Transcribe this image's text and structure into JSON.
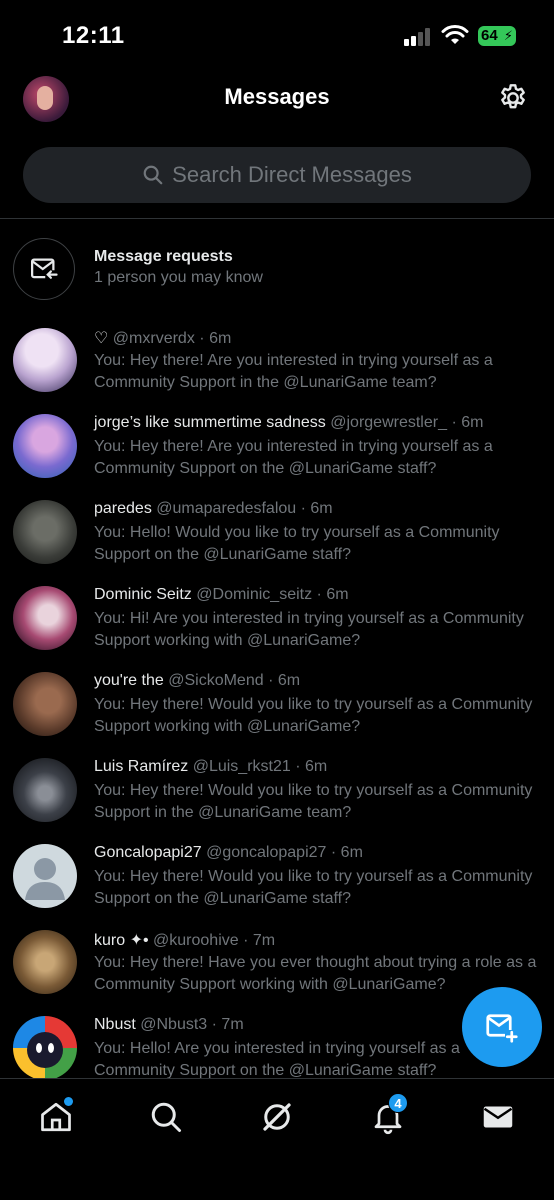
{
  "status_bar": {
    "time": "12:11",
    "battery": "64"
  },
  "header": {
    "title": "Messages"
  },
  "search": {
    "placeholder": "Search Direct Messages"
  },
  "requests": {
    "title": "Message requests",
    "subtitle": "1 person you may know"
  },
  "conversations": [
    {
      "name": "♡",
      "handle": "@mxrverdx",
      "time": "6m",
      "preview": "You: Hey there! Are you interested in trying yourself as a Community Support in the @LunariGame team?"
    },
    {
      "name": "jorge’s like summertime sadness",
      "handle": "@jorgewrestler_",
      "time": "6m",
      "preview": "You: Hey there! Are you interested in trying yourself as a Community Support on the @LunariGame staff?"
    },
    {
      "name": "paredes",
      "handle": "@umaparedesfalou",
      "time": "6m",
      "preview": "You: Hello! Would you like to try yourself as a Community Support on the @LunariGame staff?"
    },
    {
      "name": "Dominic Seitz",
      "handle": "@Dominic_seitz",
      "time": "6m",
      "preview": "You: Hi! Are you interested in trying yourself as a Community Support working with @LunariGame?"
    },
    {
      "name": "you're the",
      "handle": "@SickoMend",
      "time": "6m",
      "preview": "You: Hey there! Would you like to try yourself as a Community Support working with @LunariGame?"
    },
    {
      "name": "Luis Ramírez",
      "handle": "@Luis_rkst21",
      "time": "6m",
      "preview": "You: Hey there! Would you like to try yourself as a Community Support in the @LunariGame team?"
    },
    {
      "name": "Goncalopapi27",
      "handle": "@goncalopapi27",
      "time": "6m",
      "preview": "You: Hey there! Would you like to try yourself as a Community Support on the @LunariGame staff?"
    },
    {
      "name": "kuro ✦•",
      "handle": "@kuroohive",
      "time": "7m",
      "preview": "You: Hey there! Have you ever thought about trying a role as a Community Support working with @LunariGame?"
    },
    {
      "name": "Nbust",
      "handle": "@Nbust3",
      "time": "7m",
      "preview": "You: Hello! Are you interested in trying yourself as a Community Support on the @LunariGame staff?"
    }
  ],
  "nav": {
    "notifications_count": "4",
    "items": [
      "home-icon",
      "search-icon",
      "grok-icon",
      "bell-icon",
      "mail-icon"
    ]
  },
  "colors": {
    "accent": "#1d9bf0",
    "background": "#000000",
    "secondary_text": "#71767b",
    "search_bg": "#202327"
  }
}
